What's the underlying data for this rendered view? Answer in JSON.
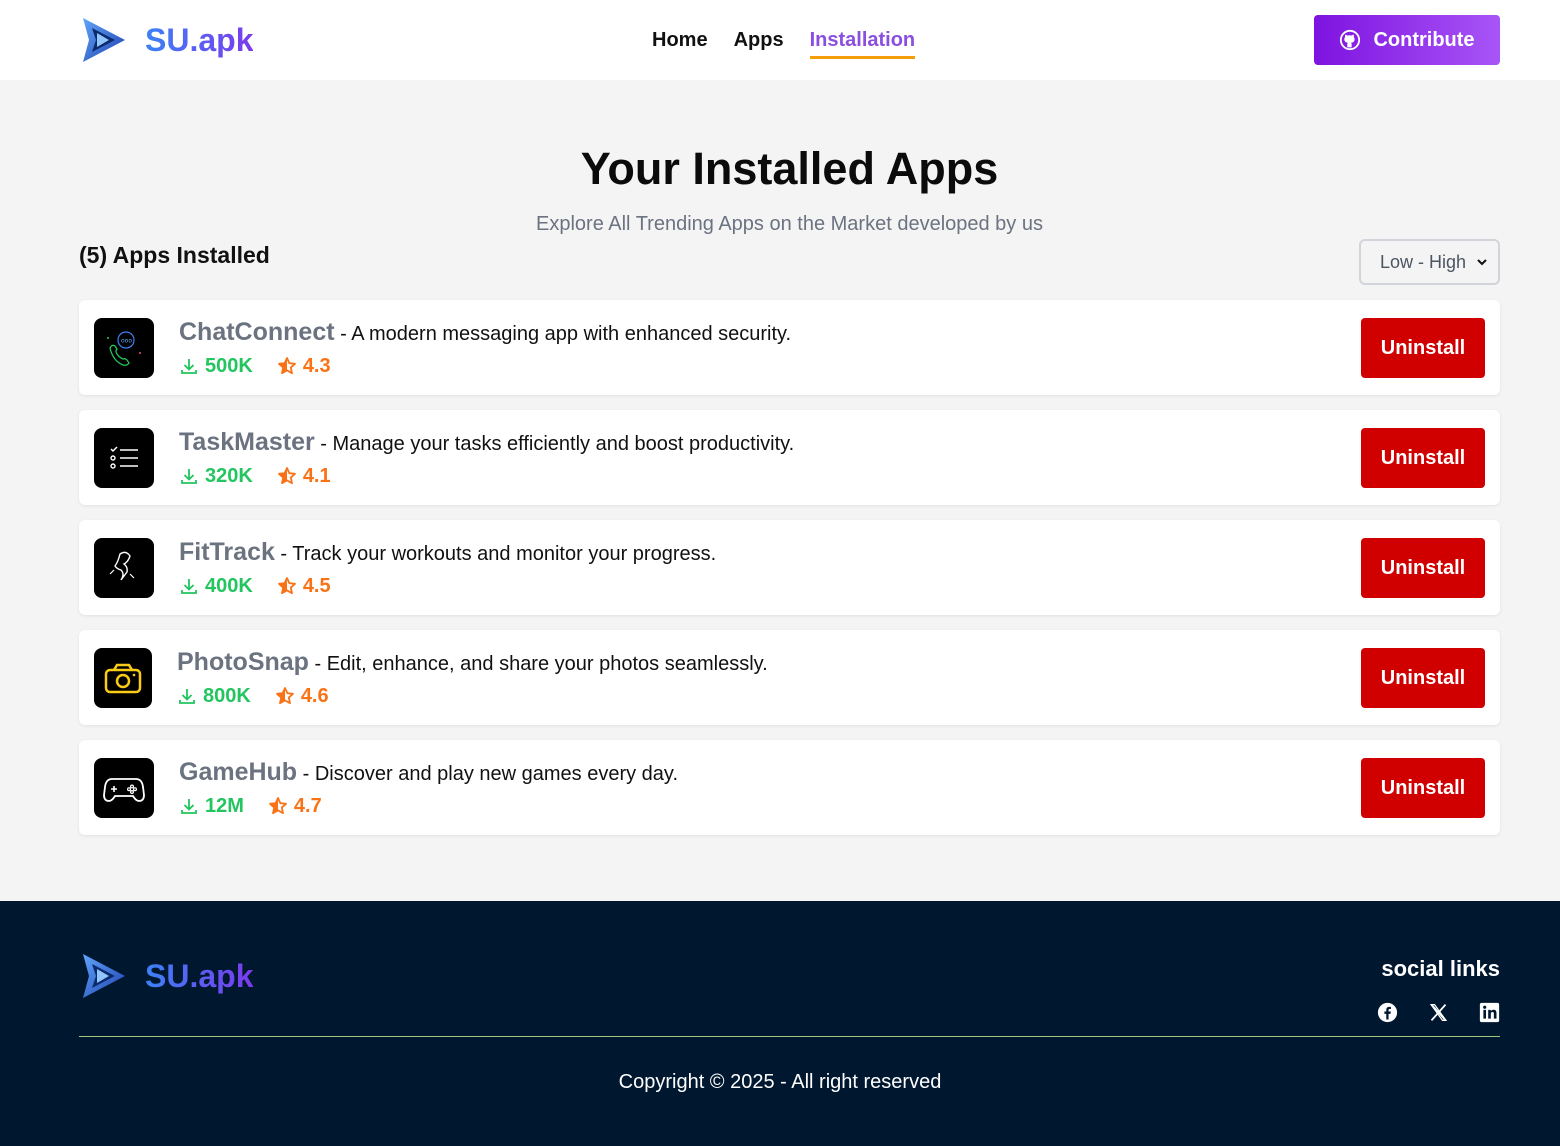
{
  "header": {
    "brand": "SU.apk",
    "nav": [
      {
        "label": "Home"
      },
      {
        "label": "Apps"
      },
      {
        "label": "Installation"
      }
    ],
    "contribute_label": "Contribute"
  },
  "main": {
    "title": "Your Installed Apps",
    "subtitle": "Explore All Trending Apps on the Market developed by us",
    "installed_count": "(5) Apps Installed",
    "sort_selected": "Low - High",
    "uninstall_label": "Uninstall",
    "apps": [
      {
        "name": "ChatConnect",
        "description": " - A modern messaging app with enhanced security.",
        "downloads": "500K",
        "rating": "4.3"
      },
      {
        "name": "TaskMaster",
        "description": " - Manage your tasks efficiently and boost productivity.",
        "downloads": "320K",
        "rating": "4.1"
      },
      {
        "name": "FitTrack",
        "description": " - Track your workouts and monitor your progress.",
        "downloads": "400K",
        "rating": "4.5"
      },
      {
        "name": "PhotoSnap",
        "description": " - Edit, enhance, and share your photos seamlessly.",
        "downloads": "800K",
        "rating": "4.6"
      },
      {
        "name": "GameHub",
        "description": " - Discover and play new games every day.",
        "downloads": "12M",
        "rating": "4.7"
      }
    ]
  },
  "footer": {
    "brand": "SU.apk",
    "social_title": "social links",
    "social_icons": [
      "facebook-icon",
      "x-icon",
      "linkedin-icon"
    ],
    "copyright": "Copyright © 2025 - All right reserved"
  },
  "colors": {
    "accent_purple": "#8b4fe0",
    "nav_underline": "#f59e0b",
    "uninstall_red": "#d10000",
    "downloads_green": "#22c55e",
    "rating_orange": "#f97316",
    "footer_bg": "#001730"
  }
}
